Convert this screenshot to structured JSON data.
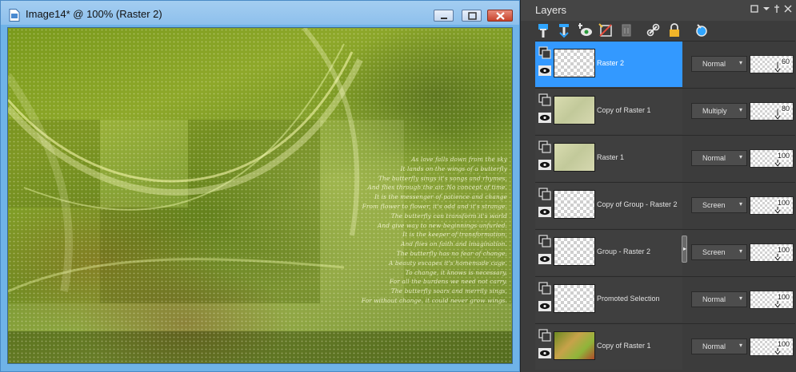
{
  "image_window": {
    "title": "Image14* @ 100% (Raster 2)",
    "poem_lines": [
      "As love falls down from the sky",
      "It lands on the wings of a butterfly",
      "The butterfly sings it's songs and rhymes,",
      "And flies through the air. No concept of time.",
      "It is the messenger of patience and change",
      "From flower to flower, it's odd and it's strange.",
      "The butterfly can transform it's world",
      "And give way to new beginnings unfurled.",
      "It is the keeper of transformation,",
      "And flies on faith and imagination.",
      "The butterfly has no fear of change,",
      "A beauty escapes it's homemade cage.",
      "To change, it knows is necessary,",
      "For all the burdens we need not carry.",
      "The butterfly soars and merrily sings,",
      "For without change, it could never grow wings."
    ]
  },
  "layers_panel": {
    "title": "Layers",
    "layers": [
      {
        "name": "Raster 2",
        "blend": "Normal",
        "opacity": "60",
        "thumb": "transparent",
        "selected": true
      },
      {
        "name": "Copy of Raster 1",
        "blend": "Multiply",
        "opacity": "80",
        "thumb": "green-soft",
        "selected": false
      },
      {
        "name": "Raster 1",
        "blend": "Normal",
        "opacity": "100",
        "thumb": "green-soft",
        "selected": false
      },
      {
        "name": "Copy of Group - Raster 2",
        "blend": "Screen",
        "opacity": "100",
        "thumb": "transparent",
        "selected": false
      },
      {
        "name": "Group - Raster 2",
        "blend": "Screen",
        "opacity": "100",
        "thumb": "transparent",
        "selected": false
      },
      {
        "name": "Promoted Selection",
        "blend": "Normal",
        "opacity": "100",
        "thumb": "transparent",
        "selected": false
      },
      {
        "name": "Copy of Raster 1",
        "blend": "Normal",
        "opacity": "100",
        "thumb": "full",
        "selected": false
      }
    ],
    "toolbar_icons": [
      "new-raster-layer-icon",
      "new-vector-layer-icon",
      "new-mask-icon",
      "new-adjustment-layer-icon",
      "delete-layer-icon",
      "link-layer-icon",
      "lock-layer-icon",
      "layer-properties-icon"
    ]
  },
  "colors": {
    "selected_row": "#3399ff",
    "panel_bg": "#3c3c3c",
    "window_frame": "#8ec0ec"
  }
}
